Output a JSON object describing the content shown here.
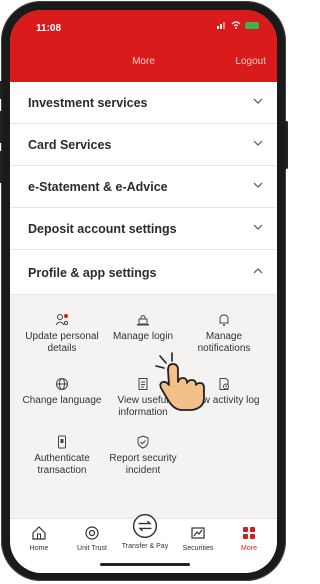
{
  "status": {
    "time": "11:08"
  },
  "header": {
    "title": "More",
    "logout": "Logout"
  },
  "sections": [
    {
      "label": "Investment services"
    },
    {
      "label": "Card Services"
    },
    {
      "label": "e-Statement & e-Advice"
    },
    {
      "label": "Deposit account settings"
    },
    {
      "label": "Profile & app settings"
    }
  ],
  "tiles": [
    {
      "label": "Update personal details"
    },
    {
      "label": "Manage login"
    },
    {
      "label": "Manage notifications"
    },
    {
      "label": "Change language"
    },
    {
      "label": "View useful information"
    },
    {
      "label": "View activity log"
    },
    {
      "label": "Authenticate transaction"
    },
    {
      "label": "Report security incident"
    }
  ],
  "nav": [
    {
      "label": "Home"
    },
    {
      "label": "Unit Trust"
    },
    {
      "label": "Transfer & Pay"
    },
    {
      "label": "Securities"
    },
    {
      "label": "More"
    }
  ],
  "colors": {
    "brand": "#da1b1b",
    "battery": "#3ab54a"
  }
}
